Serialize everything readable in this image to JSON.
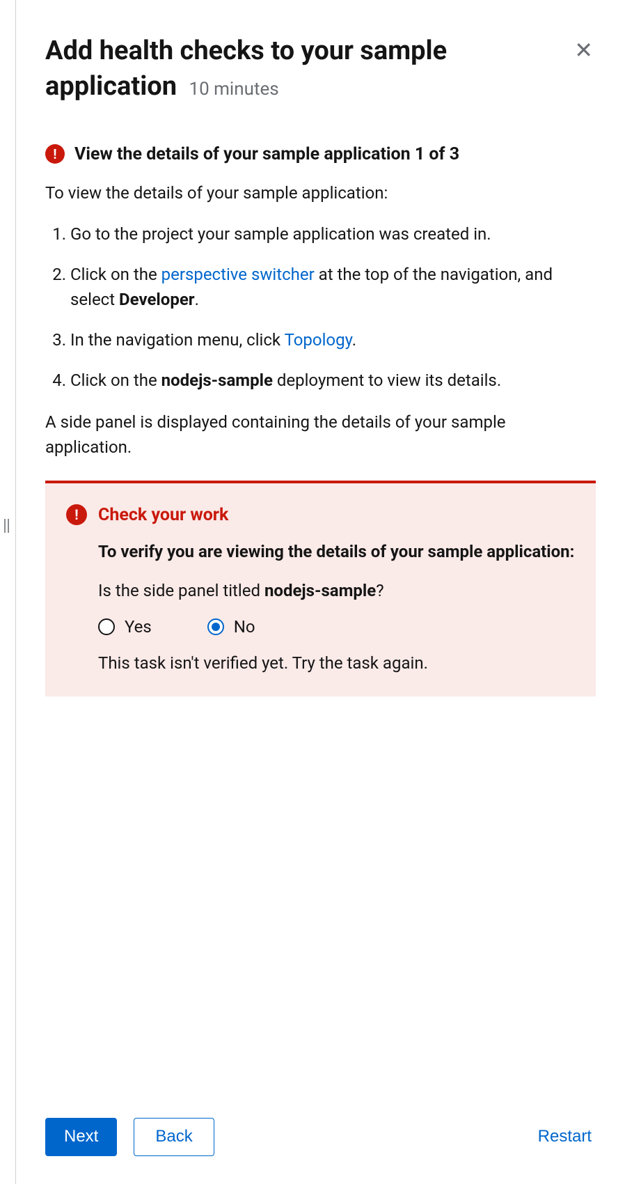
{
  "header": {
    "title": "Add health checks to your sample application",
    "duration": "10 minutes"
  },
  "step": {
    "title": "View the details of your sample application 1 of 3",
    "intro": "To view the details of your sample application:",
    "list": {
      "item1": "Go to the project your sample application was created in.",
      "item2_pre": "Click on the ",
      "item2_link": "perspective switcher",
      "item2_mid": " at the top of the navigation, and select ",
      "item2_bold": "Developer",
      "item2_post": ".",
      "item3_pre": "In the navigation menu, click ",
      "item3_link": "Topology",
      "item3_post": ".",
      "item4_pre": "Click on the ",
      "item4_bold": "nodejs-sample",
      "item4_post": " deployment to view its details."
    },
    "outro": "A side panel is displayed containing the details of your sample application."
  },
  "check": {
    "title": "Check your work",
    "instruction": "To verify you are viewing the details of your sample application:",
    "question_pre": "Is the side panel titled ",
    "question_bold": "nodejs-sample",
    "question_post": "?",
    "options": {
      "yes": "Yes",
      "no": "No"
    },
    "selected": "no",
    "feedback": "This task isn't verified yet. Try the task again."
  },
  "footer": {
    "next": "Next",
    "back": "Back",
    "restart": "Restart"
  }
}
